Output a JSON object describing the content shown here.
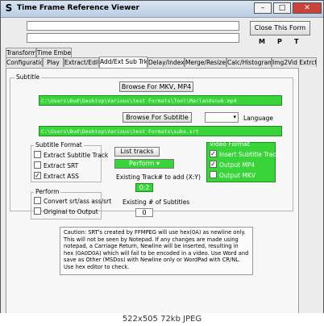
{
  "window": {
    "title": "Time Frame Reference Viewer",
    "icon": "S",
    "close_label": "Close This Form"
  },
  "toolbar": {
    "m": "M",
    "p": "P",
    "t": "T"
  },
  "tabs_row1": [
    {
      "label": "Transform"
    },
    {
      "label": "Time Embed"
    }
  ],
  "tabs_row2": [
    {
      "label": "Configuration"
    },
    {
      "label": "Play"
    },
    {
      "label": "Extract/Edit"
    },
    {
      "label": "Add/Ext Sub Trk"
    },
    {
      "label": "Delay/Index"
    },
    {
      "label": "Merge/Resize"
    },
    {
      "label": "Calc/Histogram"
    },
    {
      "label": "Img2Vid Extrct"
    }
  ],
  "subtitle_group": {
    "label": "Subtitle"
  },
  "browse_mkv_label": "Browse For MKV, MP4",
  "mkv_path": "C:\\Users\\Bud\\Desktop\\Various\\test Formats\\Tool\\Marlandsnuk.mp4",
  "browse_sub_label": "Browse For Subtitle",
  "language_label": "Language",
  "sub_path": "C:\\Users\\Bud\\Desktop\\Various\\test Formats\\subs.srt",
  "subtitle_format": {
    "label": "Subtitle Format",
    "options": [
      {
        "label": "Extract Subtitle Track",
        "checked": ""
      },
      {
        "label": "Extract SRT",
        "checked": ""
      },
      {
        "label": "Extract ASS",
        "checked": "✓"
      }
    ]
  },
  "list_tracks_label": "List tracks",
  "perform_label": "Perform",
  "existing_track_label": "Existing Track# to add (X:Y)",
  "existing_track_value": "0:2",
  "existing_count_label": "Existing # of Subtitles",
  "existing_count_value": "0",
  "video_format": {
    "label": "Video Format",
    "options": [
      {
        "label": "Insert Subtitle Track",
        "checked": "✓"
      },
      {
        "label": "Output MP4",
        "checked": "✓"
      },
      {
        "label": "Output MKV",
        "checked": ""
      }
    ]
  },
  "perform_group": {
    "label": "Perform",
    "options": [
      {
        "label": "Convert srt/ass ass/srt",
        "checked": ""
      },
      {
        "label": "Original to Output",
        "checked": ""
      }
    ]
  },
  "caution_text": "Caution: SRT's created by FFMPEG will use hex(0A) as newline only.  This will not be seen by Notepad.  If any changes are made using notepad, a Carriage Return, Newline will be inserted, resulting in hex (0A0D0A) which will fail to be encoded in a video. Use Word and save as Other (MSDos) with Newline only or WordPad with CR/NL. Use hex editor to check.",
  "image_caption": "522x505 72kb JPEG",
  "colors": {
    "green": "#39d439",
    "title_bar": "#c8d8ea",
    "close_red": "#c9433a"
  }
}
